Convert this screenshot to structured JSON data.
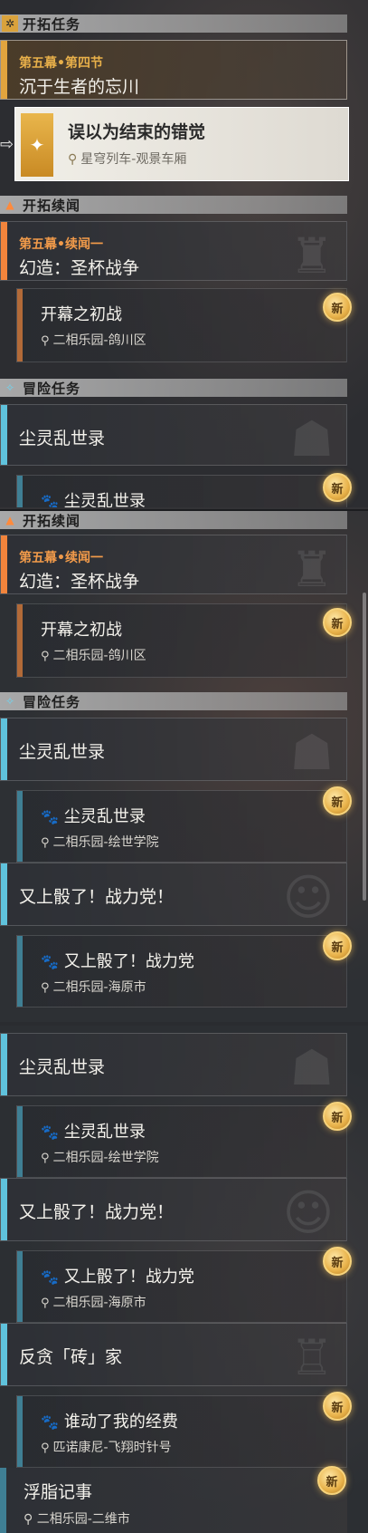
{
  "panel1": {
    "section_trailblaze": "开拓任务",
    "main_card": {
      "subtitle": "第五幕•第四节",
      "title": "沉于生者的忘川"
    },
    "selected": {
      "name": "误以为结束的错觉",
      "location": "星穹列车-观景车厢"
    },
    "section_companion": "开拓续闻",
    "companion_card": {
      "subtitle": "第五幕•续闻一",
      "title": "幻造：圣杯战争"
    },
    "companion_sub": {
      "name": "开幕之初战",
      "location": "二相乐园-鸽川区"
    },
    "section_adventure": "冒险任务",
    "adventure_card": {
      "title": "尘灵乱世录"
    },
    "adventure_sub_partial": "尘灵乱世录",
    "new_label": "新"
  },
  "panel2": {
    "section_companion": "开拓续闻",
    "companion_card": {
      "subtitle": "第五幕•续闻一",
      "title": "幻造：圣杯战争"
    },
    "companion_sub": {
      "name": "开幕之初战",
      "location": "二相乐园-鸽川区"
    },
    "section_adventure": "冒险任务",
    "card1": {
      "title": "尘灵乱世录"
    },
    "sub1": {
      "name": "尘灵乱世录",
      "location": "二相乐园-绘世学院"
    },
    "card2": {
      "title": "又上骰了！战力党！"
    },
    "sub2": {
      "name": "又上骰了！战力党",
      "location": "二相乐园-海原市"
    },
    "new_label": "新"
  },
  "panel3": {
    "card1": {
      "title": "尘灵乱世录"
    },
    "sub1": {
      "name": "尘灵乱世录",
      "location": "二相乐园-绘世学院"
    },
    "card2": {
      "title": "又上骰了！战力党！"
    },
    "sub2": {
      "name": "又上骰了！战力党",
      "location": "二相乐园-海原市"
    },
    "card3": {
      "title": "反贪「砖」家"
    },
    "sub3": {
      "name": "谁动了我的经费",
      "location": "匹诺康尼-飞翔时针号"
    },
    "card4": {
      "title": "浮脂记事",
      "location": "二相乐园-二维市"
    },
    "new_label": "新"
  },
  "colors": {
    "gold": "#e2a43e",
    "orange": "#f2843c",
    "cyan": "#5fc2dc",
    "new_badge": "#e8b24a"
  },
  "icons": {
    "trailblaze": "diamond-star-icon",
    "companion": "triangle-icon",
    "adventure": "sparkle-icon",
    "location": "pin-icon",
    "paw": "paw-icon"
  }
}
